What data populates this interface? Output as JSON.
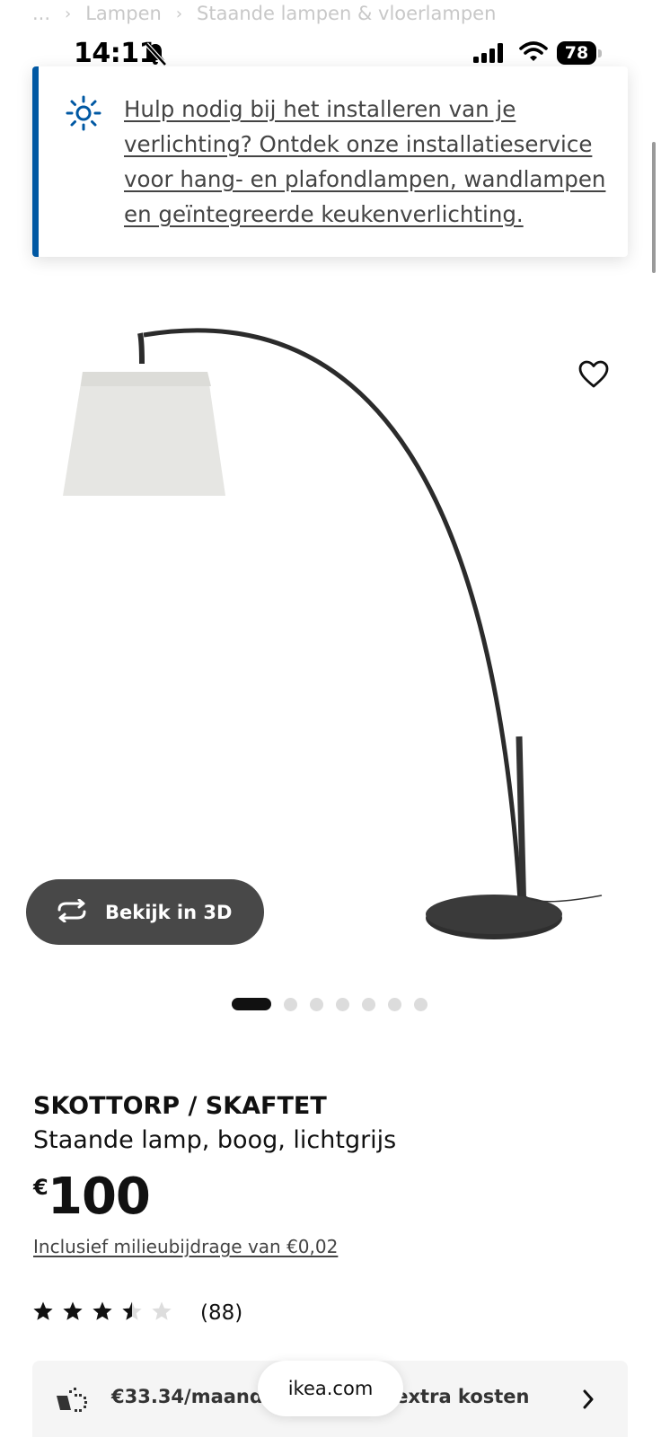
{
  "breadcrumb": {
    "ellipsis": "...",
    "items": [
      "Lampen",
      "Staande lampen & vloerlampen"
    ]
  },
  "status_bar": {
    "time": "14:11",
    "battery": "78",
    "icons": [
      "bell-slash-icon",
      "signal-icon",
      "wifi-icon",
      "battery-icon"
    ]
  },
  "notice": {
    "icon": "sun-icon",
    "text": "Hulp nodig bij het installeren van je verlichting? Ontdek onze installatieservice voor hang- en plafondlampen, wandlampen en geïntegreerde keukenverlichting.",
    "accent_color": "#0058a3"
  },
  "gallery": {
    "view_3d_label": "Bekijk in 3D",
    "image_count": 7,
    "active_index": 0
  },
  "product": {
    "name": "SKOTTORP / SKAFTET",
    "description": "Staande lamp, boog, lichtgrijs",
    "currency": "€",
    "price": "100",
    "eco_fee": "Inclusief milieubijdrage van €0,02",
    "rating_value": 3.5,
    "rating_max": 5,
    "review_count": "(88)"
  },
  "payment": {
    "text": "€33.34/maand - 3x zonder extra kosten"
  },
  "browser": {
    "url": "ikea.com"
  }
}
